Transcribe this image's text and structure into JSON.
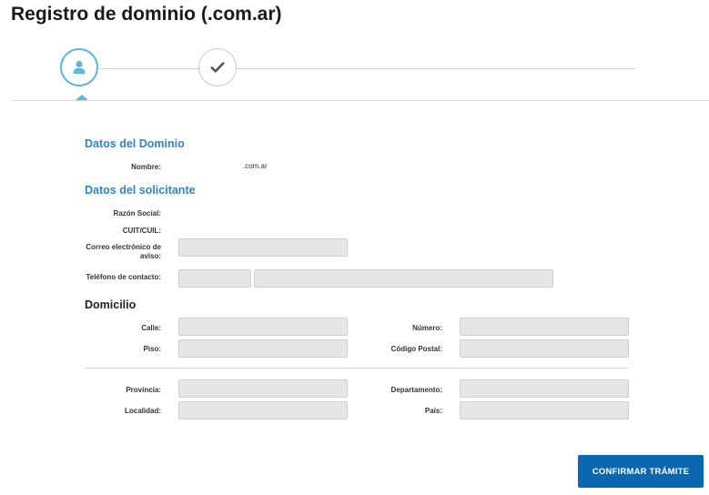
{
  "page": {
    "title": "Registro de dominio (.com.ar)"
  },
  "stepper": {
    "steps": [
      {
        "icon": "user-icon",
        "state": "active"
      },
      {
        "icon": "check-icon",
        "state": "pending"
      }
    ],
    "accent_color": "#5bb7dd"
  },
  "dominio": {
    "heading": "Datos del Dominio",
    "nombre_label": "Nombre:",
    "nombre_value": ".com.ar"
  },
  "solicitante": {
    "heading": "Datos del solicitante",
    "razon_social_label": "Razón Social:",
    "cuit_label": "CUIT/CUIL:",
    "correo_label_line1": "Correo electrónico de",
    "correo_label_line2": "aviso:",
    "correo_value": "",
    "telefono_label": "Teléfono de contacto:",
    "telefono_area_value": "",
    "telefono_numero_value": ""
  },
  "domicilio": {
    "heading": "Domicilio",
    "calle_label": "Calle:",
    "numero_label": "Número:",
    "piso_label": "Piso:",
    "codigo_postal_label": "Código Postal:",
    "provincia_label": "Provincia:",
    "departamento_label": "Departamento:",
    "localidad_label": "Localidad:",
    "pais_label": "País:"
  },
  "actions": {
    "confirm_label": "CONFIRMAR TRÁMITE",
    "confirm_color": "#0b67b0"
  }
}
